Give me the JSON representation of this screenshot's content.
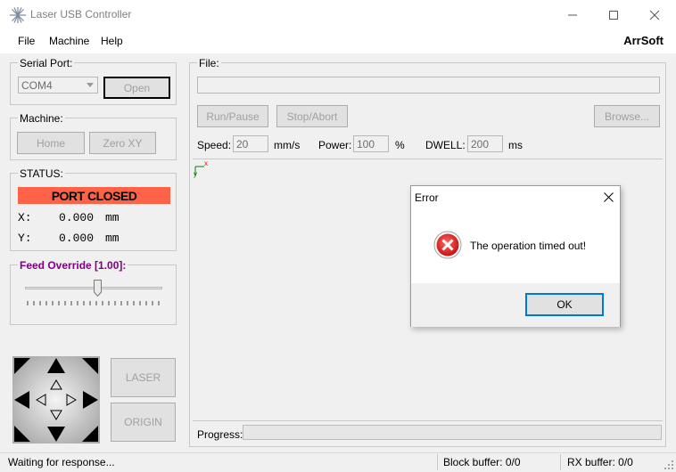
{
  "window": {
    "title": "Laser USB Controller",
    "app_icon": "starburst-icon",
    "controls": [
      "minimize-icon",
      "maximize-icon",
      "close-icon"
    ]
  },
  "menu": {
    "items": [
      "File",
      "Machine",
      "Help"
    ],
    "brand": "ArrSoft"
  },
  "serial": {
    "label": "Serial Port:",
    "port_value": "COM4",
    "open_label": "Open"
  },
  "machine": {
    "label": "Machine:",
    "home_label": "Home",
    "zero_label": "Zero XY"
  },
  "status": {
    "label": "STATUS:",
    "banner": "PORT CLOSED",
    "banner_color": "#ff6347",
    "x_label": "X:",
    "x_value": "0.000",
    "x_unit": "mm",
    "y_label": "Y:",
    "y_value": "0.000",
    "y_unit": "mm"
  },
  "feed": {
    "label": "Feed Override [1.00]:",
    "label_color": "#800080",
    "value": 1.0
  },
  "jog": {
    "laser_label": "LASER",
    "origin_label": "ORIGIN"
  },
  "file": {
    "label": "File:",
    "path_value": "",
    "run_label": "Run/Pause",
    "stop_label": "Stop/Abort",
    "browse_label": "Browse...",
    "speed_label": "Speed:",
    "speed_value": "20",
    "speed_unit": "mm/s",
    "power_label": "Power:",
    "power_value": "100",
    "power_unit": "%",
    "dwell_label": "DWELL:",
    "dwell_value": "200",
    "dwell_unit": "ms"
  },
  "canvas": {
    "axis_x": "x",
    "axis_y": "y"
  },
  "progress": {
    "label": "Progress:",
    "value": 0
  },
  "statusbar": {
    "message": "Waiting for response...",
    "block_buffer": "Block buffer: 0/0",
    "rx_buffer": "RX buffer: 0/0"
  },
  "dialog": {
    "title": "Error",
    "message": "The operation timed out!",
    "ok_label": "OK",
    "icon": "error-icon"
  }
}
